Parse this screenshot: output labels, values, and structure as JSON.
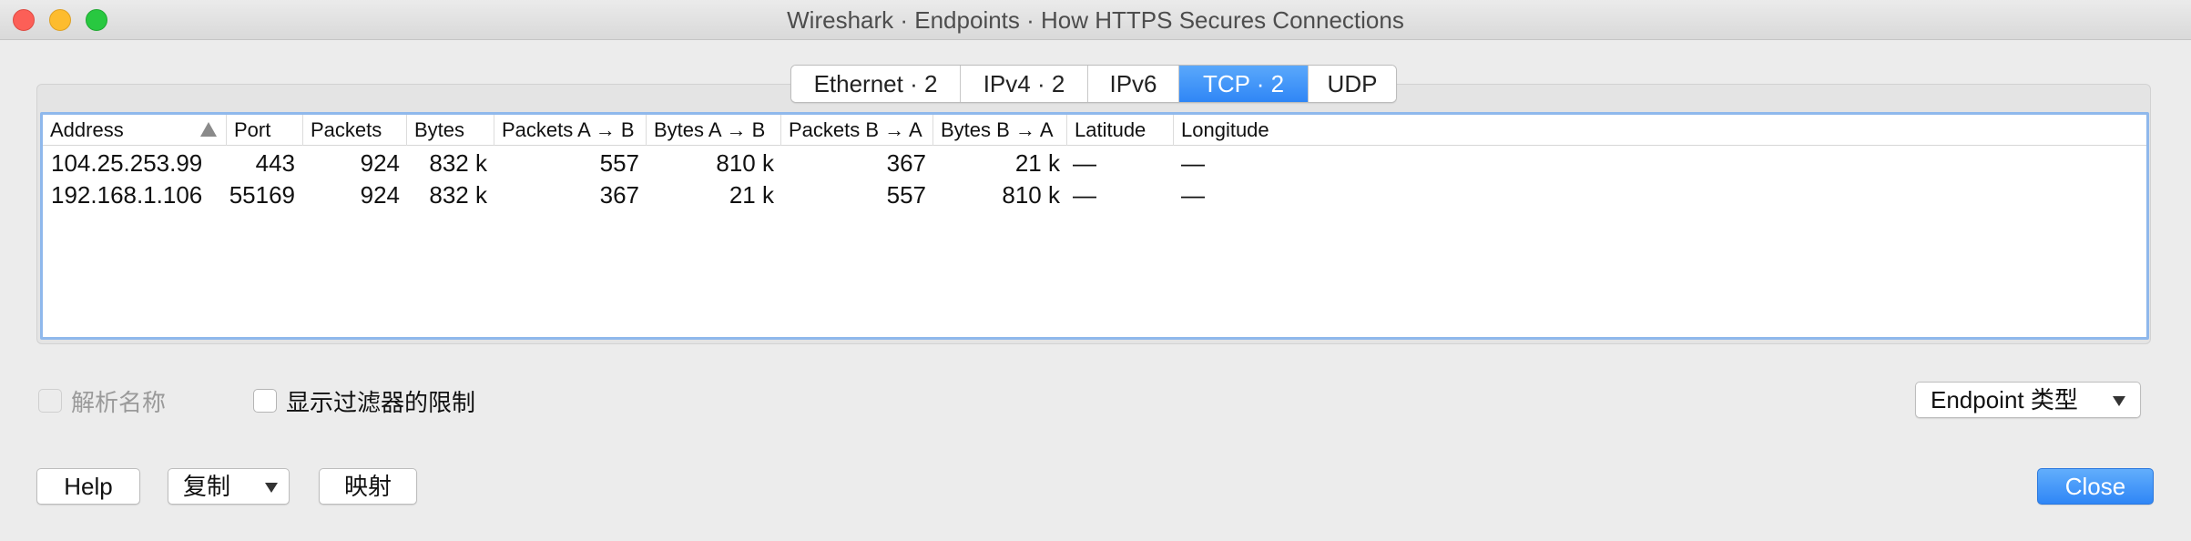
{
  "window": {
    "title": "Wireshark · Endpoints · How HTTPS Secures Connections"
  },
  "tabs": [
    {
      "label": "Ethernet · 2",
      "active": false
    },
    {
      "label": "IPv4 · 2",
      "active": false
    },
    {
      "label": "IPv6",
      "active": false
    },
    {
      "label": "TCP · 2",
      "active": true
    },
    {
      "label": "UDP",
      "active": false
    }
  ],
  "table": {
    "columns": [
      "Address",
      "Port",
      "Packets",
      "Bytes",
      "Packets A → B",
      "Bytes A → B",
      "Packets B → A",
      "Bytes B → A",
      "Latitude",
      "Longitude"
    ],
    "sort_column": "Address",
    "rows": [
      [
        "104.25.253.99",
        "443",
        "924",
        "832 k",
        "557",
        "810 k",
        "367",
        "21 k",
        "—",
        "—"
      ],
      [
        "192.168.1.106",
        "55169",
        "924",
        "832 k",
        "367",
        "21 k",
        "557",
        "810 k",
        "—",
        "—"
      ]
    ]
  },
  "options": {
    "resolve_names": {
      "label": "解析名称",
      "checked": false,
      "disabled": true
    },
    "limit_to_filter": {
      "label": "显示过滤器的限制",
      "checked": false
    }
  },
  "endpoint_type": {
    "label": "Endpoint 类型"
  },
  "buttons": {
    "help": "Help",
    "copy": "复制",
    "map": "映射",
    "close": "Close"
  },
  "colors": {
    "accent": "#2f86f6",
    "table_focus_border": "#8fb8ec",
    "close_traffic": "#fc5f57",
    "minimize_traffic": "#fdbc2e",
    "zoom_traffic": "#28c840"
  }
}
